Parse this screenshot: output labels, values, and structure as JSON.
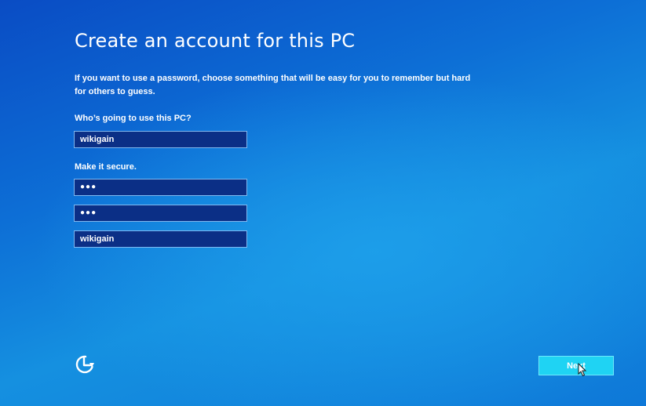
{
  "setup": {
    "title": "Create an account for this PC",
    "description": "If you want to use a password, choose something that will be easy for you to remember but hard for others to guess.",
    "user_label": "Who’s going to use this PC?",
    "username_value": "wikigain",
    "secure_label": "Make it secure.",
    "password_value": "●●●",
    "reenter_password_value": "●●●",
    "hint_value": "wikigain",
    "next_label": "Next"
  },
  "icons": {
    "ease_of_access": "ease-of-access-icon",
    "cursor": "mouse-cursor-icon"
  },
  "colors": {
    "background": "#0d6fd6",
    "field_bg": "#0b2f86",
    "field_border": "#7fb8f0",
    "next_button_bg": "#1fd3f3"
  }
}
